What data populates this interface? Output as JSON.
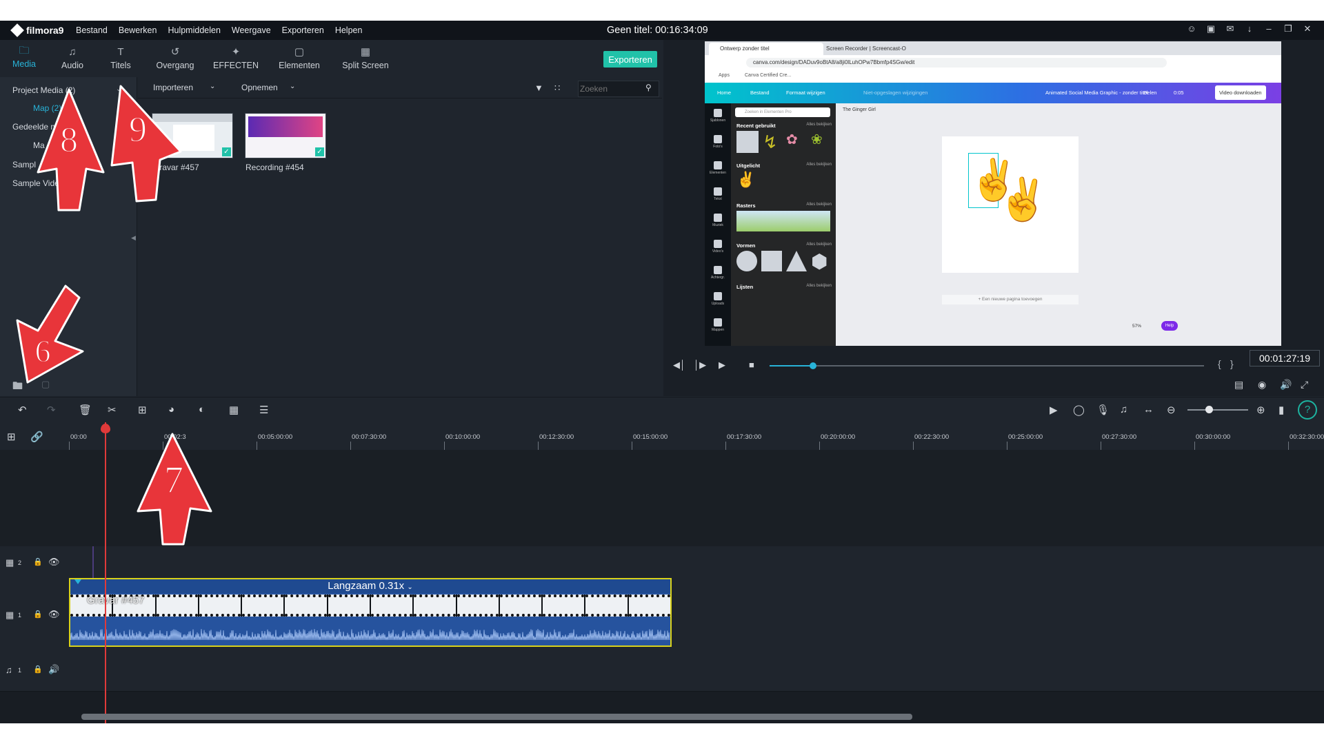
{
  "app": {
    "name": "filmora9",
    "menu": [
      "Bestand",
      "Bewerken",
      "Hulpmiddelen",
      "Weergave",
      "Exporteren",
      "Helpen"
    ],
    "title": "Geen titel:",
    "duration": "00:16:34:09"
  },
  "tabs": [
    {
      "label": "Media",
      "icon": "folder-icon",
      "active": true
    },
    {
      "label": "Audio",
      "icon": "music-note-icon"
    },
    {
      "label": "Titels",
      "icon": "text-icon"
    },
    {
      "label": "Overgang",
      "icon": "transition-icon"
    },
    {
      "label": "EFFECTEN",
      "icon": "effects-icon"
    },
    {
      "label": "Elementen",
      "icon": "elements-icon"
    },
    {
      "label": "Split Screen",
      "icon": "split-screen-icon"
    }
  ],
  "export_label": "Exporteren",
  "library": {
    "project_media": "Project Media (2)",
    "folder": "Map (2)",
    "shared": "Gedeelde m",
    "shared_sub": "Ma",
    "sample1": "Sampl",
    "sample2": "Sample Vide"
  },
  "media_toolbar": {
    "import": "Importeren",
    "record": "Opnemen",
    "search_placeholder": "Zoeken"
  },
  "media_items": [
    {
      "label": "Gravar #457"
    },
    {
      "label": "Recording #454"
    }
  ],
  "preview": {
    "browser_tabs": [
      "Ontwerp zonder titel",
      "Screen Recorder | Screencast-O"
    ],
    "url": "canva.com/design/DADuv9oBtA8/a8ji0lLuhOPw7Bbmfp4SGw/edit",
    "bookmarks": [
      "Apps",
      "Canva Certified Cre..."
    ],
    "canva_bar": {
      "home": "Home",
      "file": "Bestand",
      "resize": "Formaat wijzigen",
      "unsaved": "Niet-opgeslagen wijzigingen",
      "doc": "Animated Social Media Graphic - zonder titel",
      "share": "Delen",
      "time": "0:05",
      "download": "Video downloaden"
    },
    "side_icons": [
      "Sjablonen",
      "Foto's",
      "Elementen",
      "Tekst",
      "Muziek",
      "Video's",
      "Achtergr.",
      "Uploads",
      "Mappen"
    ],
    "panel": {
      "search": "Zoeken in Elementen Pro",
      "sections": [
        "Recent gebruikt",
        "Uitgelicht",
        "Rasters",
        "Vormen",
        "Lijsten"
      ],
      "see_all": "Alles bekijken"
    },
    "audio_track": "The Ginger Girl",
    "add_page": "+ Een nieuwe pagina toevoegen",
    "zoom": "57%",
    "help": "Help",
    "timecode": "00:01:27:19",
    "progress": 0.1
  },
  "ruler": [
    "00:00",
    "00:02:3",
    "00:05:00:00",
    "00:07:30:00",
    "00:10:00:00",
    "00:12:30:00",
    "00:15:00:00",
    "00:17:30:00",
    "00:20:00:00",
    "00:22:30:00",
    "00:25:00:00",
    "00:27:30:00",
    "00:30:00:00",
    "00:32:30:00"
  ],
  "tracks": {
    "v2": "2",
    "v1": "1",
    "a1": "1"
  },
  "clip": {
    "speed": "Langzaam 0.31x",
    "name": "Gravar #457"
  },
  "annotations": [
    "8",
    "9",
    "6",
    "7"
  ],
  "colors": {
    "accent": "#28b3d8",
    "export": "#21c2a9",
    "clip": "#26539e",
    "playhead": "#e03a3a",
    "annotation": "#e8353a"
  }
}
